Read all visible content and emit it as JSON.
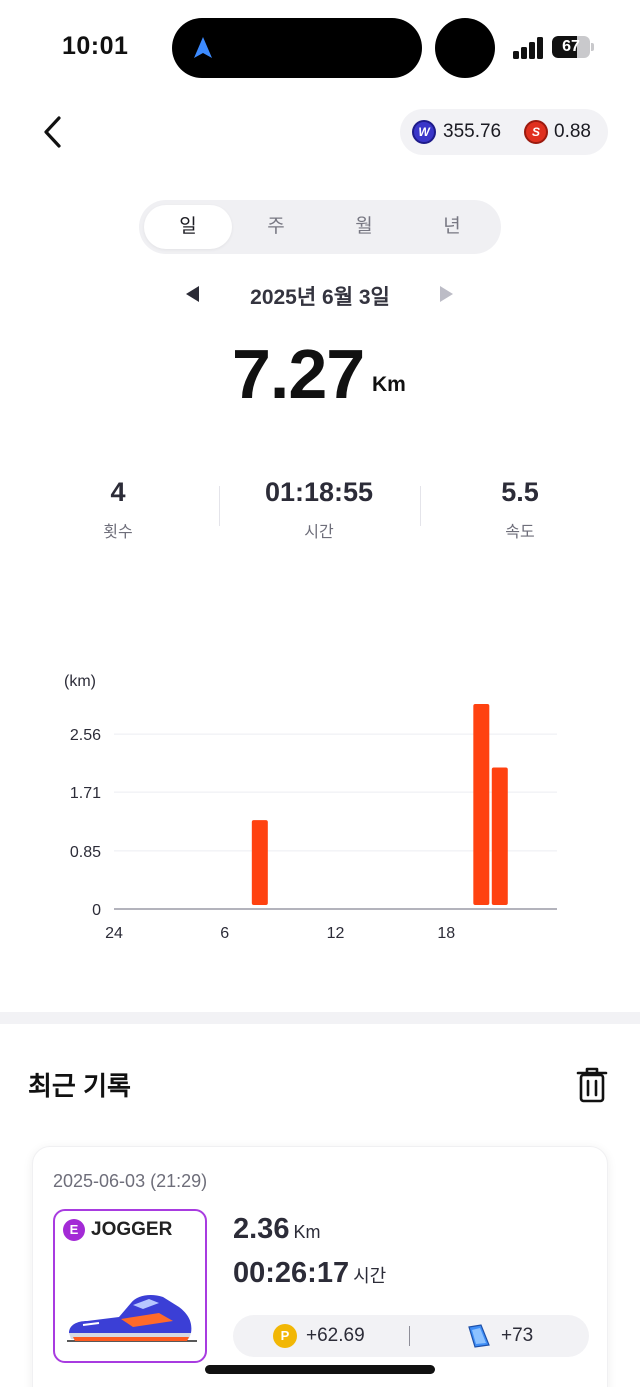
{
  "status_bar": {
    "time": "10:01",
    "battery": "67",
    "battery_level": 0.67
  },
  "header": {
    "wallet": {
      "w_coin_symbol": "W",
      "w_value": "355.76",
      "s_coin_symbol": "S",
      "s_value": "0.88"
    }
  },
  "period_tabs": [
    {
      "label": "일",
      "active": true
    },
    {
      "label": "주",
      "active": false
    },
    {
      "label": "월",
      "active": false
    },
    {
      "label": "년",
      "active": false
    }
  ],
  "date": "2025년 6월 3일",
  "distance": {
    "value": "7.27",
    "unit": "Km"
  },
  "stats": [
    {
      "value": "4",
      "label": "횟수"
    },
    {
      "value": "01:18:55",
      "label": "시간"
    },
    {
      "value": "5.5",
      "label": "속도"
    }
  ],
  "chart_data": {
    "type": "bar",
    "ylabel": "(km)",
    "y_ticks": [
      "2.56",
      "1.71",
      "0.85",
      "0"
    ],
    "y_tick_values": [
      2.56,
      1.71,
      0.85,
      0
    ],
    "x_ticks": [
      "24",
      "6",
      "12",
      "18"
    ],
    "x_tick_hours": [
      0,
      6,
      12,
      18
    ],
    "x_range": [
      0,
      24
    ],
    "ylim": [
      0,
      3.0
    ],
    "grid": true,
    "bar_color": "#ff4210",
    "bars": [
      {
        "hour": 7.9,
        "value": 1.3
      },
      {
        "hour": 19.9,
        "value": 3.0
      },
      {
        "hour": 20.9,
        "value": 2.07
      }
    ]
  },
  "recent": {
    "title": "최근 기록",
    "records": [
      {
        "datetime": "2025-06-03 (21:29)",
        "shoe_badge": "E",
        "shoe_grade": "JOGGER",
        "km": "2.36",
        "km_unit": "Km",
        "time": "00:26:17",
        "time_unit": "시간",
        "reward_points": "+62.69",
        "reward_map": "+73"
      }
    ]
  },
  "colors": {
    "accent": "#ff4210",
    "grade_purple": "#a32ad6",
    "point_gold": "#f2b705"
  }
}
